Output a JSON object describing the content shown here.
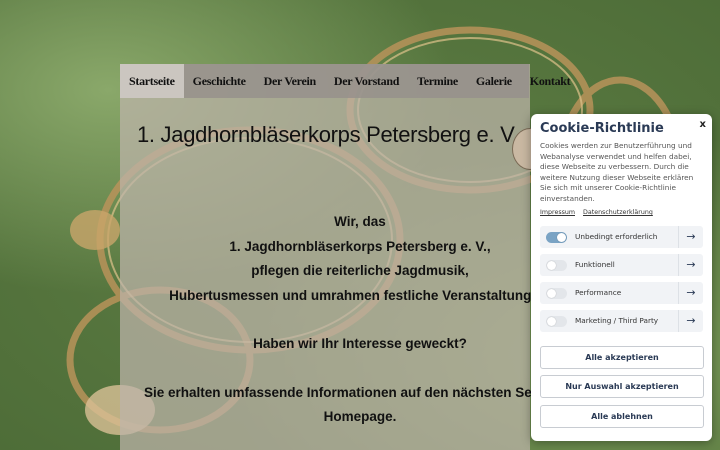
{
  "nav": {
    "items": [
      {
        "label": "Startseite",
        "active": true
      },
      {
        "label": "Geschichte"
      },
      {
        "label": "Der Verein"
      },
      {
        "label": "Der Vorstand"
      },
      {
        "label": "Termine"
      },
      {
        "label": "Galerie"
      },
      {
        "label": "Kontakt"
      }
    ]
  },
  "page": {
    "title": "1. Jagdhornbläserkorps Petersberg e. V.",
    "intro_lines": [
      "Wir, das",
      "1. Jagdhornbläserkorps Petersberg e. V.,",
      "pflegen die reiterliche Jagdmusik,",
      "Hubertusmessen und umrahmen festliche Veranstaltungen."
    ],
    "question": "Haben wir Ihr Interesse geweckt?",
    "info_lines": [
      "Sie erhalten umfassende Informationen auf den nächsten Seiten un",
      "Homepage."
    ]
  },
  "cookie": {
    "close": "x",
    "title": "Cookie-Richtlinie",
    "description": "Cookies werden zur Benutzerführung und Webanalyse verwendet und helfen dabei, diese Webseite zu verbessern. Durch die weitere Nutzung dieser Webseite erklären Sie sich mit unserer Cookie-Richtlinie einverstanden.",
    "links": [
      "Impressum",
      "Datenschutzerklärung"
    ],
    "categories": [
      {
        "label": "Unbedingt erforderlich",
        "enabled": true
      },
      {
        "label": "Funktionell",
        "enabled": false
      },
      {
        "label": "Performance",
        "enabled": false
      },
      {
        "label": "Marketing / Third Party",
        "enabled": false
      }
    ],
    "arrow": "→",
    "buttons": {
      "accept_all": "Alle akzeptieren",
      "accept_selection": "Nur Auswahl akzeptieren",
      "reject_all": "Alle ablehnen"
    },
    "colors": {
      "title": "#2a3a55",
      "toggle_on": "#7aa3c4"
    }
  }
}
